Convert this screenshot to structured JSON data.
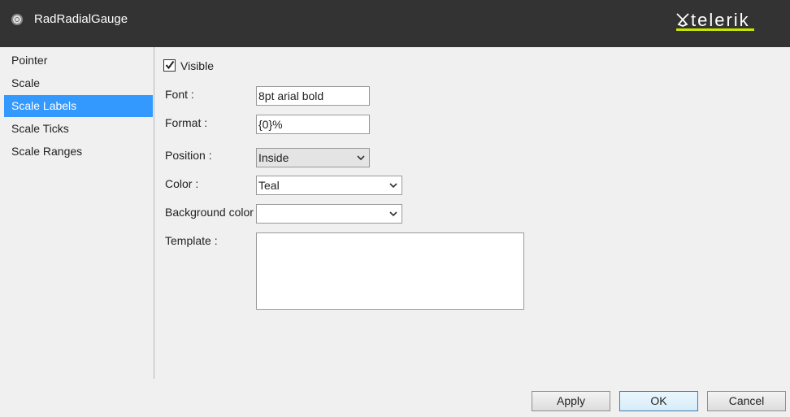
{
  "titlebar": {
    "title": "RadRadialGauge",
    "brand": "telerik",
    "brand_accent": "#c8e600"
  },
  "sidebar": {
    "items": [
      {
        "label": "Pointer"
      },
      {
        "label": "Scale"
      },
      {
        "label": "Scale Labels",
        "active": true
      },
      {
        "label": "Scale Ticks"
      },
      {
        "label": "Scale Ranges"
      }
    ]
  },
  "form": {
    "visible": {
      "label": "Visible",
      "checked": true
    },
    "font": {
      "label": "Font :",
      "value": "8pt arial bold"
    },
    "format": {
      "label": "Format :",
      "value": "{0}%"
    },
    "position": {
      "label": "Position :",
      "value": "Inside"
    },
    "color": {
      "label": "Color :",
      "value": "Teal"
    },
    "background_color": {
      "label": "Background color :",
      "value": ""
    },
    "template": {
      "label": "Template :",
      "value": ""
    }
  },
  "buttons": {
    "apply": "Apply",
    "ok": "OK",
    "cancel": "Cancel"
  },
  "colors": {
    "titlebar": "#333333",
    "selection": "#3399ff"
  }
}
